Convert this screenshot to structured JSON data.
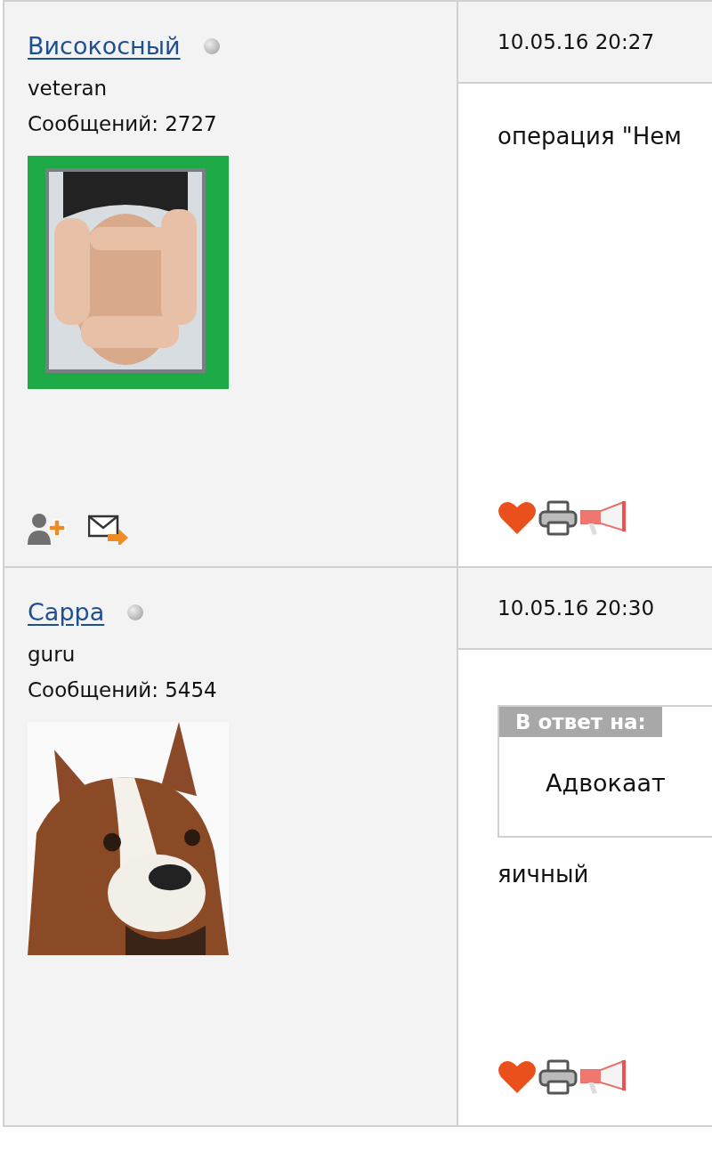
{
  "posts": [
    {
      "author": {
        "name": "Високосный",
        "online": false,
        "rank": "veteran",
        "posts_label": "Сообщений: 2727",
        "actions": [
          {
            "kind": "add-friend"
          },
          {
            "kind": "message"
          }
        ]
      },
      "date": "10.05.16 20:27",
      "body": "операция \"Нем",
      "post_actions": [
        {
          "kind": "like"
        },
        {
          "kind": "print"
        },
        {
          "kind": "report"
        }
      ]
    },
    {
      "author": {
        "name": "Cappa",
        "online": false,
        "rank": "guru",
        "posts_label": "Сообщений: 5454"
      },
      "date": "10.05.16 20:30",
      "quote": {
        "label": "В ответ на:",
        "text": "Адвокаат"
      },
      "body": "яичный",
      "post_actions": [
        {
          "kind": "like"
        },
        {
          "kind": "print"
        },
        {
          "kind": "report"
        }
      ]
    }
  ]
}
